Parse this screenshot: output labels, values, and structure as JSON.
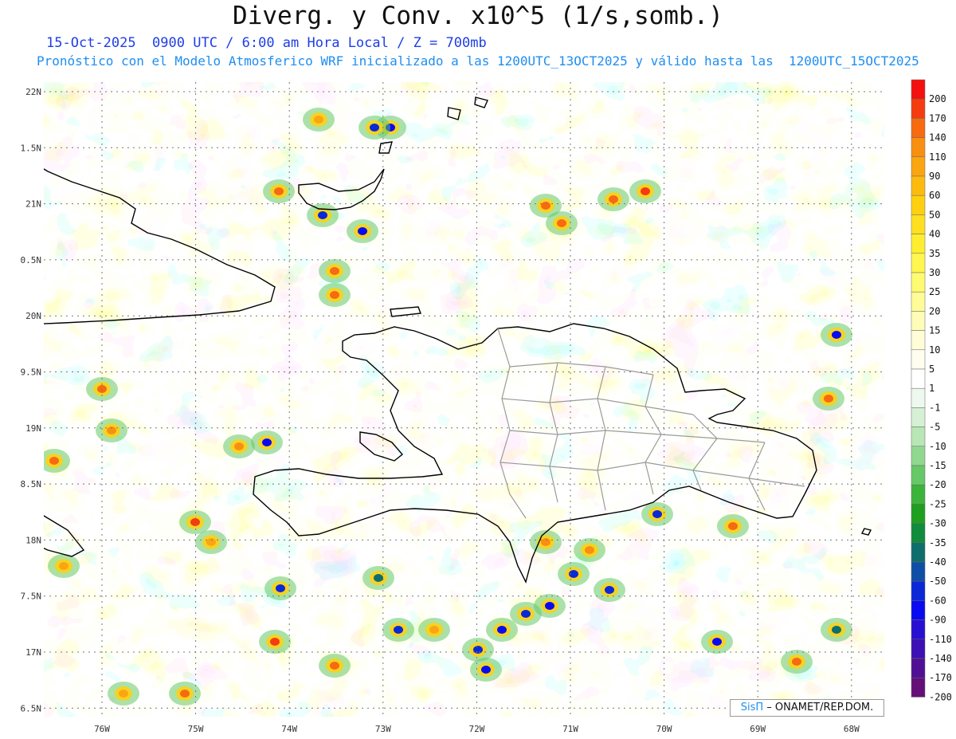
{
  "header": {
    "title": "Diverg. y Conv. x10^5 (1/s,somb.)",
    "subtitle_line1": "15-Oct-2025  0900 UTC / 6:00 am Hora Local / Z = 700mb",
    "subtitle_line2": "Pronóstico con el Modelo Atmosferico WRF inicializado a las 1200UTC_13OCT2025 y válido hasta las  1200UTC_15OCT2025"
  },
  "axes": {
    "lat_labels": [
      "22N",
      "1.5N",
      "21N",
      "0.5N",
      "20N",
      "9.5N",
      "19N",
      "8.5N",
      "18N",
      "7.5N",
      "17N",
      "6.5N"
    ],
    "lon_labels": [
      "76W",
      "75W",
      "74W",
      "73W",
      "72W",
      "71W",
      "70W",
      "69W",
      "68W"
    ]
  },
  "colorbar": {
    "labels": [
      "200",
      "170",
      "140",
      "110",
      "90",
      "60",
      "50",
      "40",
      "35",
      "30",
      "25",
      "20",
      "15",
      "10",
      "5",
      "1",
      "-1",
      "-5",
      "-10",
      "-15",
      "-20",
      "-25",
      "-30",
      "-35",
      "-40",
      "-50",
      "-60",
      "-90",
      "-110",
      "-140",
      "-170",
      "-200"
    ],
    "colors": [
      "#f51010",
      "#f53c10",
      "#f76a10",
      "#f98f10",
      "#fba510",
      "#fdbb10",
      "#ffd010",
      "#ffe020",
      "#ffee30",
      "#fff650",
      "#fffb70",
      "#fffc98",
      "#fffcb8",
      "#fffdd8",
      "#fffeee",
      "#ffffff",
      "#eef8ee",
      "#d6f0d4",
      "#b8e6b4",
      "#90d890",
      "#66c866",
      "#3cb43c",
      "#1ea01e",
      "#108c3c",
      "#0e6e6e",
      "#0e4ea6",
      "#0a28d6",
      "#0a0af0",
      "#2810d2",
      "#3c10b4",
      "#501096",
      "#641078"
    ]
  },
  "credit": {
    "brand": "SisΠ",
    "text": "– ONAMET/REP.DOM."
  }
}
